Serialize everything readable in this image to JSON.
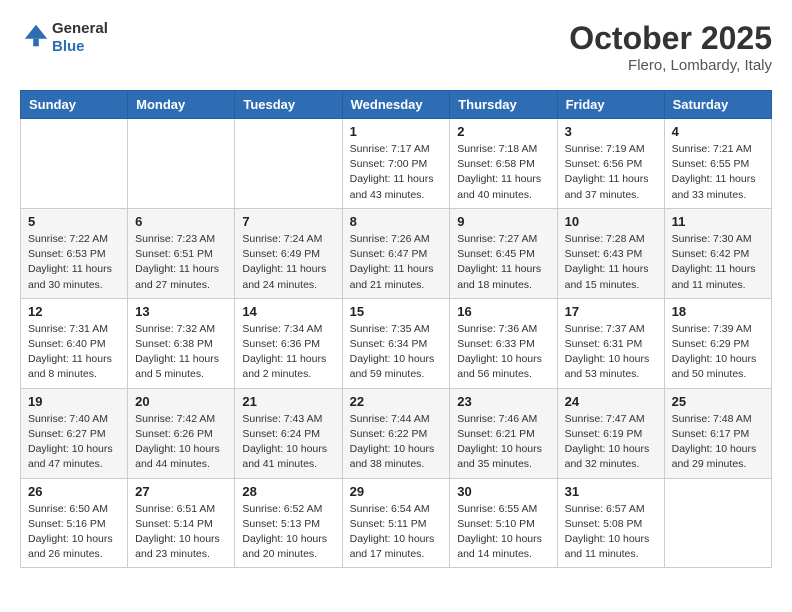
{
  "header": {
    "logo_line1": "General",
    "logo_line2": "Blue",
    "month": "October 2025",
    "location": "Flero, Lombardy, Italy"
  },
  "days_of_week": [
    "Sunday",
    "Monday",
    "Tuesday",
    "Wednesday",
    "Thursday",
    "Friday",
    "Saturday"
  ],
  "weeks": [
    [
      {
        "day": "",
        "info": ""
      },
      {
        "day": "",
        "info": ""
      },
      {
        "day": "",
        "info": ""
      },
      {
        "day": "1",
        "info": "Sunrise: 7:17 AM\nSunset: 7:00 PM\nDaylight: 11 hours\nand 43 minutes."
      },
      {
        "day": "2",
        "info": "Sunrise: 7:18 AM\nSunset: 6:58 PM\nDaylight: 11 hours\nand 40 minutes."
      },
      {
        "day": "3",
        "info": "Sunrise: 7:19 AM\nSunset: 6:56 PM\nDaylight: 11 hours\nand 37 minutes."
      },
      {
        "day": "4",
        "info": "Sunrise: 7:21 AM\nSunset: 6:55 PM\nDaylight: 11 hours\nand 33 minutes."
      }
    ],
    [
      {
        "day": "5",
        "info": "Sunrise: 7:22 AM\nSunset: 6:53 PM\nDaylight: 11 hours\nand 30 minutes."
      },
      {
        "day": "6",
        "info": "Sunrise: 7:23 AM\nSunset: 6:51 PM\nDaylight: 11 hours\nand 27 minutes."
      },
      {
        "day": "7",
        "info": "Sunrise: 7:24 AM\nSunset: 6:49 PM\nDaylight: 11 hours\nand 24 minutes."
      },
      {
        "day": "8",
        "info": "Sunrise: 7:26 AM\nSunset: 6:47 PM\nDaylight: 11 hours\nand 21 minutes."
      },
      {
        "day": "9",
        "info": "Sunrise: 7:27 AM\nSunset: 6:45 PM\nDaylight: 11 hours\nand 18 minutes."
      },
      {
        "day": "10",
        "info": "Sunrise: 7:28 AM\nSunset: 6:43 PM\nDaylight: 11 hours\nand 15 minutes."
      },
      {
        "day": "11",
        "info": "Sunrise: 7:30 AM\nSunset: 6:42 PM\nDaylight: 11 hours\nand 11 minutes."
      }
    ],
    [
      {
        "day": "12",
        "info": "Sunrise: 7:31 AM\nSunset: 6:40 PM\nDaylight: 11 hours\nand 8 minutes."
      },
      {
        "day": "13",
        "info": "Sunrise: 7:32 AM\nSunset: 6:38 PM\nDaylight: 11 hours\nand 5 minutes."
      },
      {
        "day": "14",
        "info": "Sunrise: 7:34 AM\nSunset: 6:36 PM\nDaylight: 11 hours\nand 2 minutes."
      },
      {
        "day": "15",
        "info": "Sunrise: 7:35 AM\nSunset: 6:34 PM\nDaylight: 10 hours\nand 59 minutes."
      },
      {
        "day": "16",
        "info": "Sunrise: 7:36 AM\nSunset: 6:33 PM\nDaylight: 10 hours\nand 56 minutes."
      },
      {
        "day": "17",
        "info": "Sunrise: 7:37 AM\nSunset: 6:31 PM\nDaylight: 10 hours\nand 53 minutes."
      },
      {
        "day": "18",
        "info": "Sunrise: 7:39 AM\nSunset: 6:29 PM\nDaylight: 10 hours\nand 50 minutes."
      }
    ],
    [
      {
        "day": "19",
        "info": "Sunrise: 7:40 AM\nSunset: 6:27 PM\nDaylight: 10 hours\nand 47 minutes."
      },
      {
        "day": "20",
        "info": "Sunrise: 7:42 AM\nSunset: 6:26 PM\nDaylight: 10 hours\nand 44 minutes."
      },
      {
        "day": "21",
        "info": "Sunrise: 7:43 AM\nSunset: 6:24 PM\nDaylight: 10 hours\nand 41 minutes."
      },
      {
        "day": "22",
        "info": "Sunrise: 7:44 AM\nSunset: 6:22 PM\nDaylight: 10 hours\nand 38 minutes."
      },
      {
        "day": "23",
        "info": "Sunrise: 7:46 AM\nSunset: 6:21 PM\nDaylight: 10 hours\nand 35 minutes."
      },
      {
        "day": "24",
        "info": "Sunrise: 7:47 AM\nSunset: 6:19 PM\nDaylight: 10 hours\nand 32 minutes."
      },
      {
        "day": "25",
        "info": "Sunrise: 7:48 AM\nSunset: 6:17 PM\nDaylight: 10 hours\nand 29 minutes."
      }
    ],
    [
      {
        "day": "26",
        "info": "Sunrise: 6:50 AM\nSunset: 5:16 PM\nDaylight: 10 hours\nand 26 minutes."
      },
      {
        "day": "27",
        "info": "Sunrise: 6:51 AM\nSunset: 5:14 PM\nDaylight: 10 hours\nand 23 minutes."
      },
      {
        "day": "28",
        "info": "Sunrise: 6:52 AM\nSunset: 5:13 PM\nDaylight: 10 hours\nand 20 minutes."
      },
      {
        "day": "29",
        "info": "Sunrise: 6:54 AM\nSunset: 5:11 PM\nDaylight: 10 hours\nand 17 minutes."
      },
      {
        "day": "30",
        "info": "Sunrise: 6:55 AM\nSunset: 5:10 PM\nDaylight: 10 hours\nand 14 minutes."
      },
      {
        "day": "31",
        "info": "Sunrise: 6:57 AM\nSunset: 5:08 PM\nDaylight: 10 hours\nand 11 minutes."
      },
      {
        "day": "",
        "info": ""
      }
    ]
  ]
}
